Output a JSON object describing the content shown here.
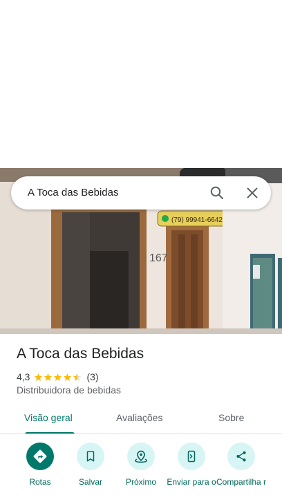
{
  "search": {
    "query": "A Toca das Bebidas"
  },
  "photo": {
    "sign_phone": "(79) 99941-6642",
    "house_number": "167"
  },
  "place": {
    "name": "A Toca das Bebidas",
    "rating": "4,3",
    "stars": 4.3,
    "review_count": "(3)",
    "category": "Distribuidora de bebidas"
  },
  "tabs": [
    {
      "label": "Visão geral",
      "active": true
    },
    {
      "label": "Avaliações",
      "active": false
    },
    {
      "label": "Sobre",
      "active": false
    }
  ],
  "actions": [
    {
      "label": "Rotas",
      "icon": "directions-icon"
    },
    {
      "label": "Salvar",
      "icon": "bookmark-icon"
    },
    {
      "label": "Próximo",
      "icon": "nearby-icon"
    },
    {
      "label": "Enviar para o",
      "icon": "send-to-phone-icon"
    },
    {
      "label": "Compartilha r",
      "icon": "share-icon"
    }
  ],
  "colors": {
    "accent": "#00796b",
    "action_bg": "#d7f5f5",
    "star": "#fbbc04"
  }
}
